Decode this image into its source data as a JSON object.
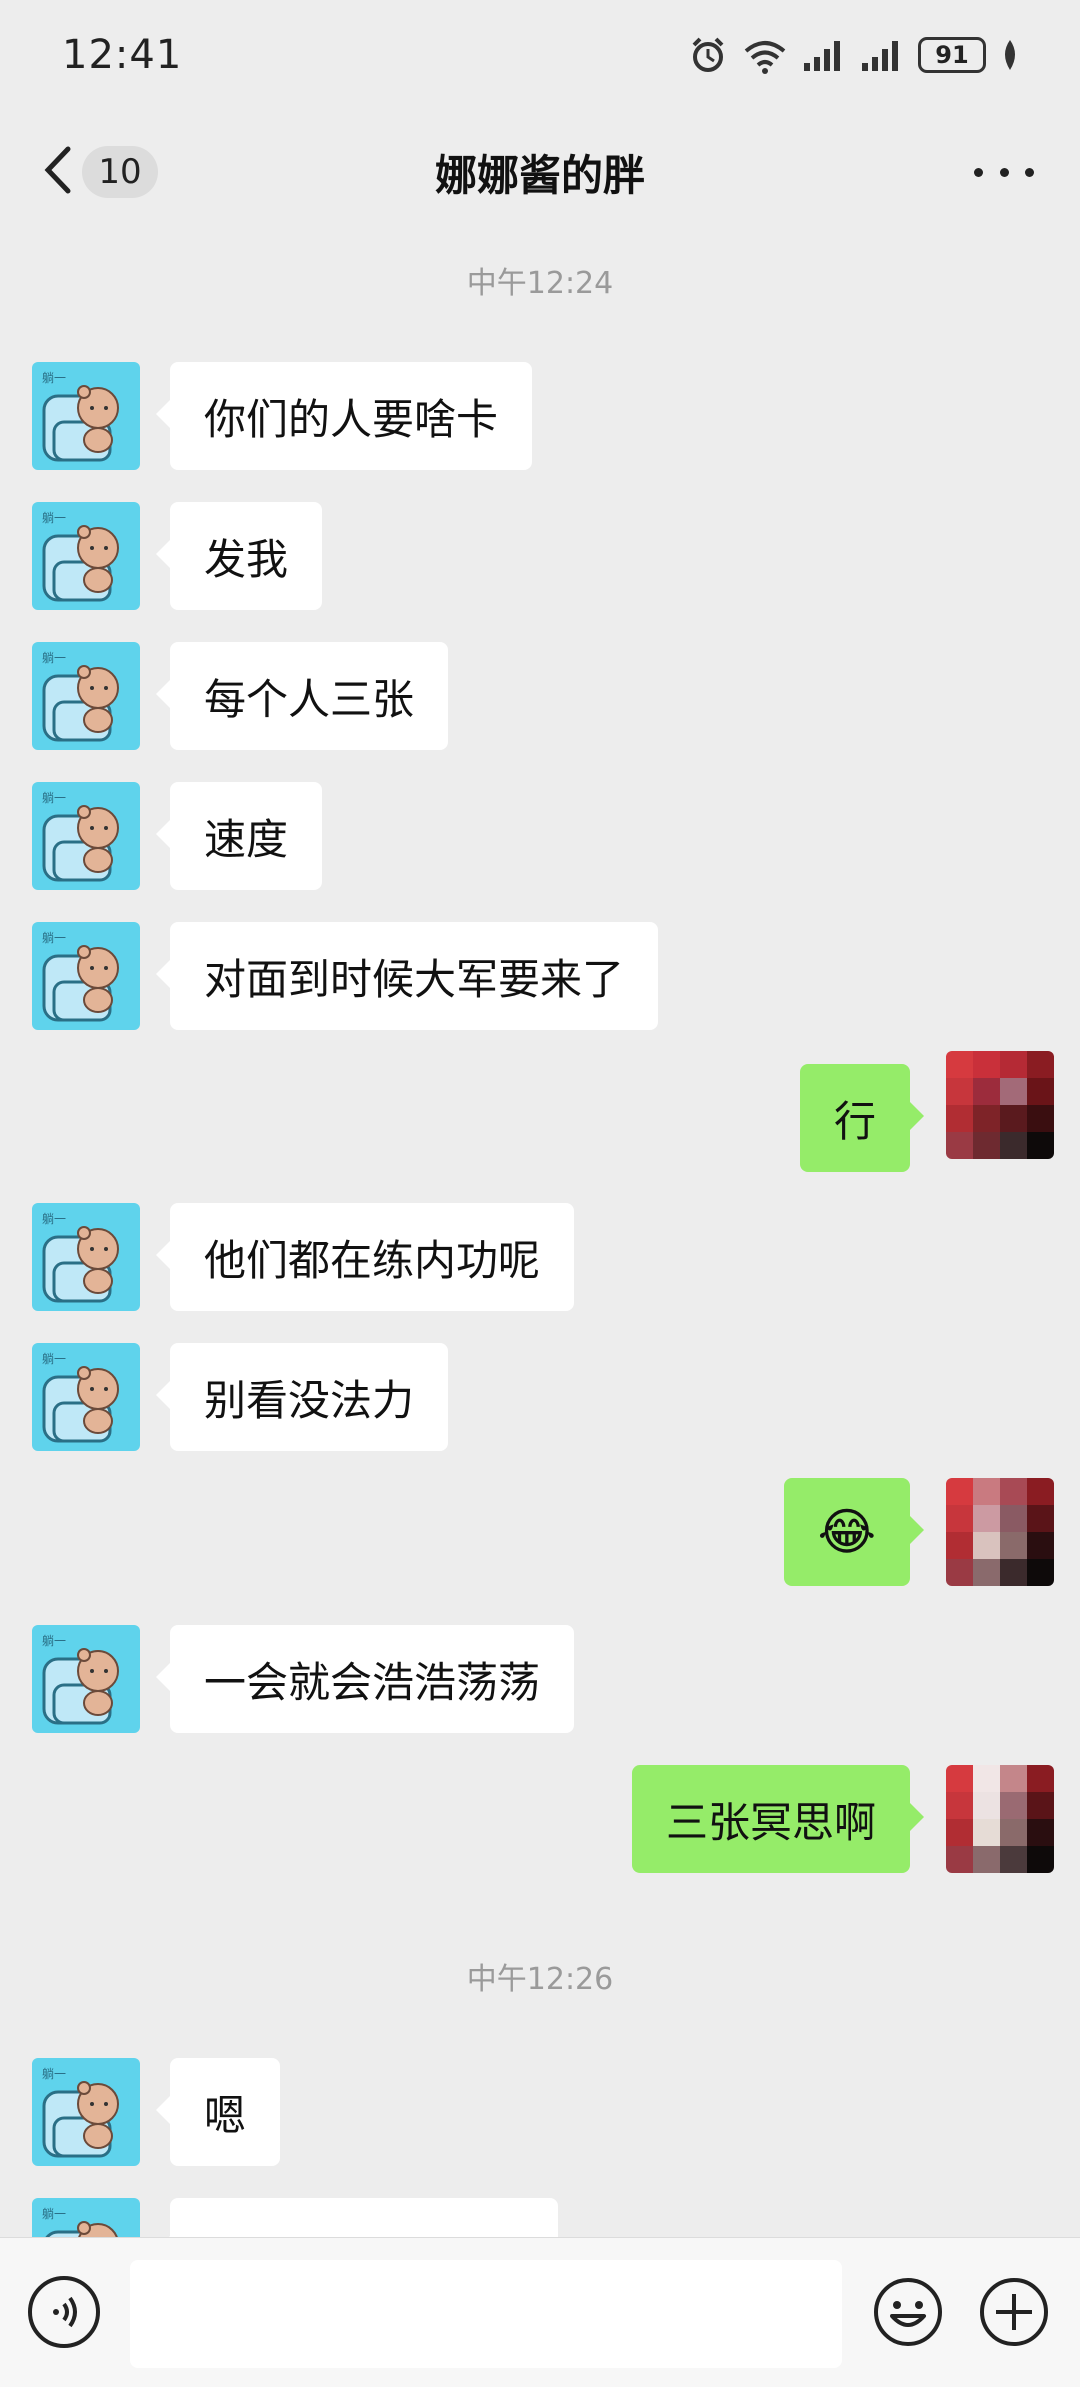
{
  "status_bar": {
    "time": "12:41",
    "battery": "91"
  },
  "header": {
    "unread_count": "10",
    "title": "娜娜酱的胖"
  },
  "timestamps": [
    "中午12:24",
    "中午12:26"
  ],
  "messages": [
    {
      "side": "in",
      "text": "你们的人要啥卡"
    },
    {
      "side": "in",
      "text": "发我"
    },
    {
      "side": "in",
      "text": "每个人三张"
    },
    {
      "side": "in",
      "text": "速度"
    },
    {
      "side": "in",
      "text": "对面到时候大军要来了"
    },
    {
      "side": "out",
      "text": "行"
    },
    {
      "side": "in",
      "text": "他们都在练内功呢"
    },
    {
      "side": "in",
      "text": "别看没法力"
    },
    {
      "side": "out",
      "text": "😂",
      "type": "emoji"
    },
    {
      "side": "in",
      "text": "一会就会浩浩荡荡"
    },
    {
      "side": "out",
      "text": "三张冥思啊"
    },
    {
      "side": "in",
      "text": "嗯"
    }
  ],
  "colors": {
    "background": "#ededed",
    "bubble_in": "#ffffff",
    "bubble_out": "#95ec69",
    "avatar_bg": "#5fd3ec"
  },
  "icons": {
    "back": "chevron-left-icon",
    "more": "more-dots-icon",
    "voice": "voice-icon",
    "emoji": "smiley-icon",
    "plus": "plus-icon",
    "status": [
      "alarm-icon",
      "wifi-icon",
      "signal-icon",
      "battery-icon"
    ]
  }
}
